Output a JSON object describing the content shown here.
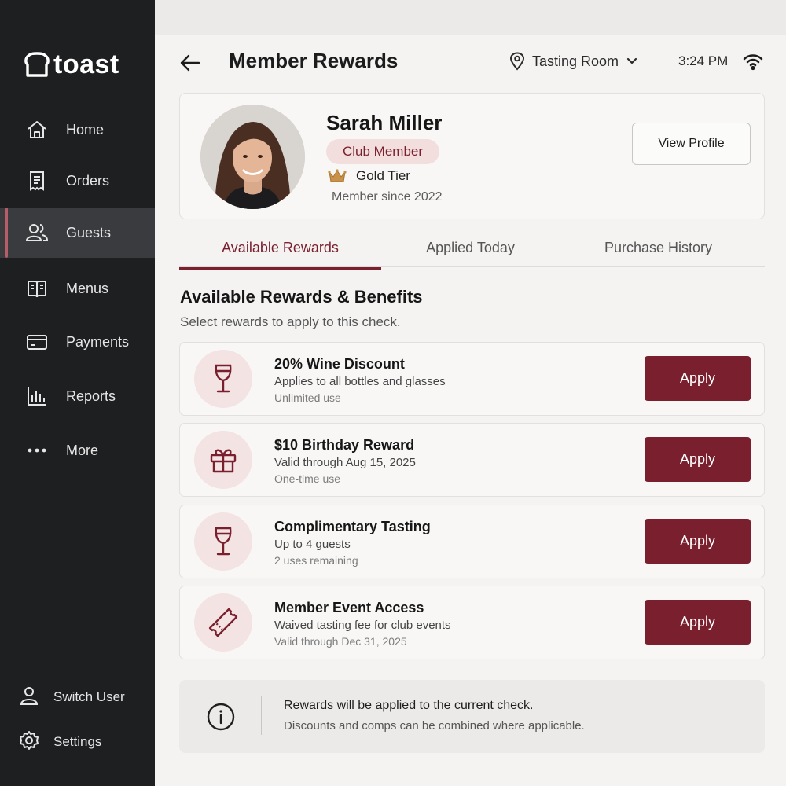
{
  "brand": {
    "name": "toast"
  },
  "sidebar": {
    "items": [
      {
        "label": "Home",
        "icon": "home-icon"
      },
      {
        "label": "Orders",
        "icon": "receipt-icon"
      },
      {
        "label": "Guests",
        "icon": "users-icon",
        "active": true
      },
      {
        "label": "Menus",
        "icon": "book-icon"
      },
      {
        "label": "Payments",
        "icon": "card-icon"
      },
      {
        "label": "Reports",
        "icon": "chart-icon"
      },
      {
        "label": "More",
        "icon": "more-icon"
      }
    ],
    "bottom": [
      {
        "label": "Switch User",
        "icon": "user-icon"
      },
      {
        "label": "Settings",
        "icon": "gear-icon"
      }
    ]
  },
  "header": {
    "title": "Member Rewards",
    "location": "Tasting Room",
    "time": "3:24 PM"
  },
  "member": {
    "name": "Sarah Miller",
    "badge": "Club Member",
    "tier": "Gold Tier",
    "since": "Member since 2022",
    "view_profile": "View Profile"
  },
  "tabs": [
    {
      "label": "Available Rewards",
      "active": true
    },
    {
      "label": "Applied Today"
    },
    {
      "label": "Purchase History"
    }
  ],
  "section": {
    "title": "Available Rewards & Benefits",
    "subtitle": "Select rewards to apply to this check."
  },
  "rewards": [
    {
      "icon": "wine-glass-icon",
      "title": "20% Wine Discount",
      "line1": "Applies to all bottles and glasses",
      "line2": "Unlimited use",
      "action": "Apply"
    },
    {
      "icon": "gift-icon",
      "title": "$10 Birthday Reward",
      "line1": "Valid through Aug 15, 2025",
      "line2": "One-time use",
      "action": "Apply"
    },
    {
      "icon": "wine-glass-icon",
      "title": "Complimentary Tasting",
      "line1": "Up to 4 guests",
      "line2": "2 uses remaining",
      "action": "Apply"
    },
    {
      "icon": "ticket-icon",
      "title": "Member Event Access",
      "line1": "Waived tasting fee for club events",
      "line2": "Valid through Dec 31, 2025",
      "action": "Apply"
    }
  ],
  "info": {
    "title": "Rewards will be applied to the current check.",
    "subtitle": "Discounts and comps can be combined where applicable."
  },
  "colors": {
    "accent": "#7a1f2e",
    "badge_bg": "#f3dede",
    "sidebar_bg": "#1e1f21",
    "sidebar_active": "#3a3b3e",
    "icon_circle": "#f3e3e3"
  }
}
